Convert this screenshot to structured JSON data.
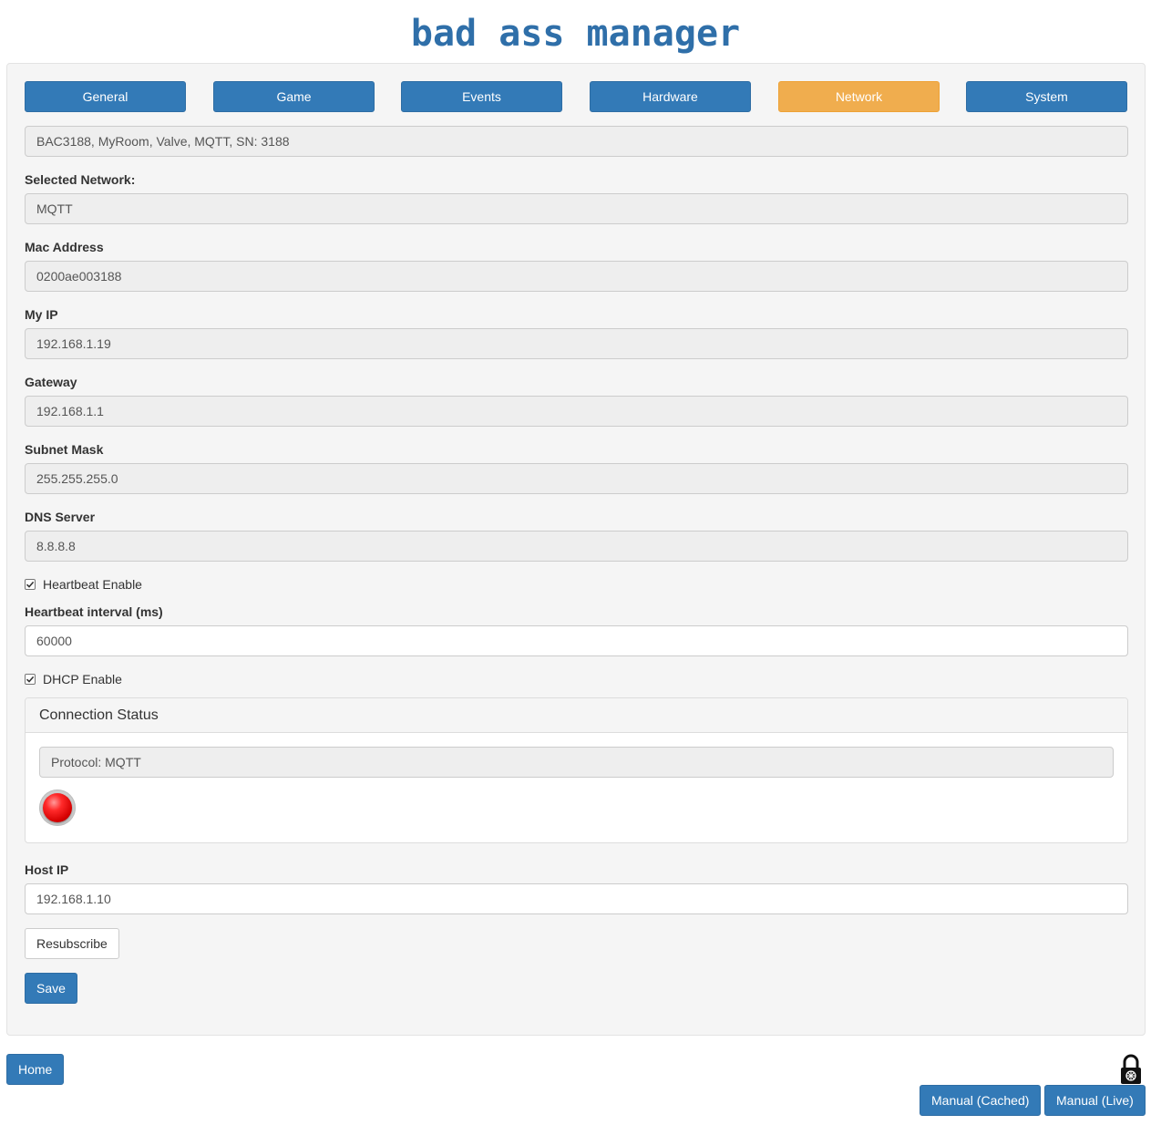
{
  "app": {
    "title": "bad ass manager"
  },
  "tabs": [
    {
      "label": "General",
      "active": false
    },
    {
      "label": "Game",
      "active": false
    },
    {
      "label": "Events",
      "active": false
    },
    {
      "label": "Hardware",
      "active": false
    },
    {
      "label": "Network",
      "active": true
    },
    {
      "label": "System",
      "active": false
    }
  ],
  "colors": {
    "primary": "#337ab7",
    "active_tab": "#f0ad4e",
    "panel_bg": "#f5f5f5",
    "status_led": "#ff0000"
  },
  "device": {
    "summary": "BAC3188, MyRoom, Valve, MQTT, SN: 3188"
  },
  "network": {
    "selected_network_label": "Selected Network:",
    "selected_network_value": "MQTT",
    "mac_label": "Mac Address",
    "mac_value": "0200ae003188",
    "ip_label": "My IP",
    "ip_value": "192.168.1.19",
    "gateway_label": "Gateway",
    "gateway_value": "192.168.1.1",
    "subnet_label": "Subnet Mask",
    "subnet_value": "255.255.255.0",
    "dns_label": "DNS Server",
    "dns_value": "8.8.8.8",
    "heartbeat_enable_label": "Heartbeat Enable",
    "heartbeat_enable_checked": true,
    "heartbeat_interval_label": "Heartbeat interval (ms)",
    "heartbeat_interval_value": "60000",
    "dhcp_enable_label": "DHCP Enable",
    "dhcp_enable_checked": true
  },
  "connection_status": {
    "heading": "Connection Status",
    "protocol": "Protocol: MQTT",
    "led_icon": "red-status-led-icon"
  },
  "host": {
    "label": "Host IP",
    "value": "192.168.1.10"
  },
  "buttons": {
    "resubscribe": "Resubscribe",
    "save": "Save",
    "home": "Home",
    "manual_cached": "Manual (Cached)",
    "manual_live": "Manual (Live)"
  },
  "icons": {
    "lock": "padlock-icon"
  }
}
